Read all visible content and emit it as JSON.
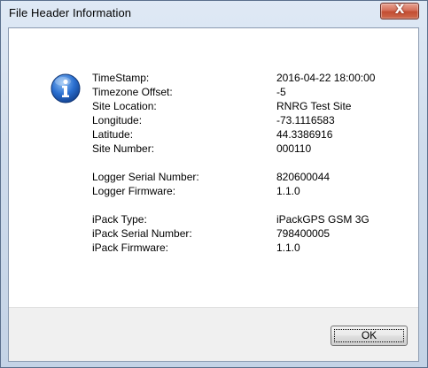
{
  "window": {
    "title": "File Header Information",
    "close_glyph": "X"
  },
  "icon": "info-icon",
  "groups": [
    {
      "rows": [
        {
          "label": "TimeStamp:",
          "value": "2016-04-22 18:00:00"
        },
        {
          "label": "Timezone Offset:",
          "value": "-5"
        },
        {
          "label": "Site Location:",
          "value": "RNRG Test Site"
        },
        {
          "label": "Longitude:",
          "value": "-73.1116583"
        },
        {
          "label": "Latitude:",
          "value": "44.3386916"
        },
        {
          "label": "Site Number:",
          "value": "000110"
        }
      ]
    },
    {
      "rows": [
        {
          "label": "Logger Serial Number:",
          "value": "820600044"
        },
        {
          "label": "Logger Firmware:",
          "value": "1.1.0"
        }
      ]
    },
    {
      "rows": [
        {
          "label": "iPack Type:",
          "value": "iPackGPS GSM 3G"
        },
        {
          "label": "iPack Serial Number:",
          "value": "798400005"
        },
        {
          "label": "iPack Firmware:",
          "value": "1.1.0"
        }
      ]
    }
  ],
  "buttons": {
    "ok_label": "OK"
  },
  "colors": {
    "info_icon_blue": "#1f63c4",
    "close_button": "#c94f34"
  }
}
